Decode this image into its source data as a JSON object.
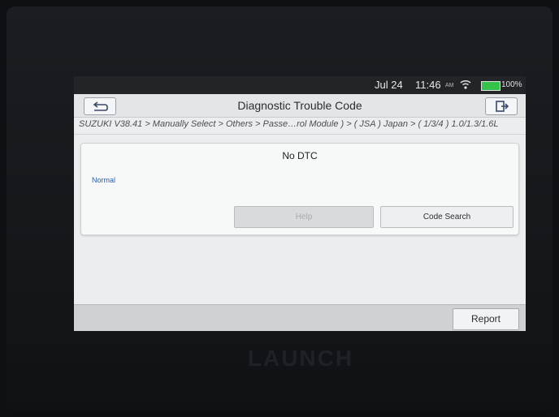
{
  "status_bar": {
    "date": "Jul 24",
    "time": "11:46",
    "ampm": "AM",
    "battery": "100%",
    "wifi_icon": "wifi-icon",
    "battery_icon": "battery-icon",
    "battery_color": "#35c24a"
  },
  "header": {
    "title": "Diagnostic Trouble Code",
    "back_icon": "back-arrow-icon",
    "exit_icon": "exit-icon"
  },
  "breadcrumb": "SUZUKI V38.41 > Manually Select > Others > Passe…rol Module ) > ( JSA ) Japan > ( 1/3/4 ) 1.0/1.3/1.6L",
  "dtc": {
    "title": "No DTC",
    "status": "Normal",
    "status_color": "#2a5fa8"
  },
  "buttons": {
    "help": "Help",
    "code_search": "Code Search",
    "report": "Report"
  },
  "device": {
    "brand": "LAUNCH"
  }
}
